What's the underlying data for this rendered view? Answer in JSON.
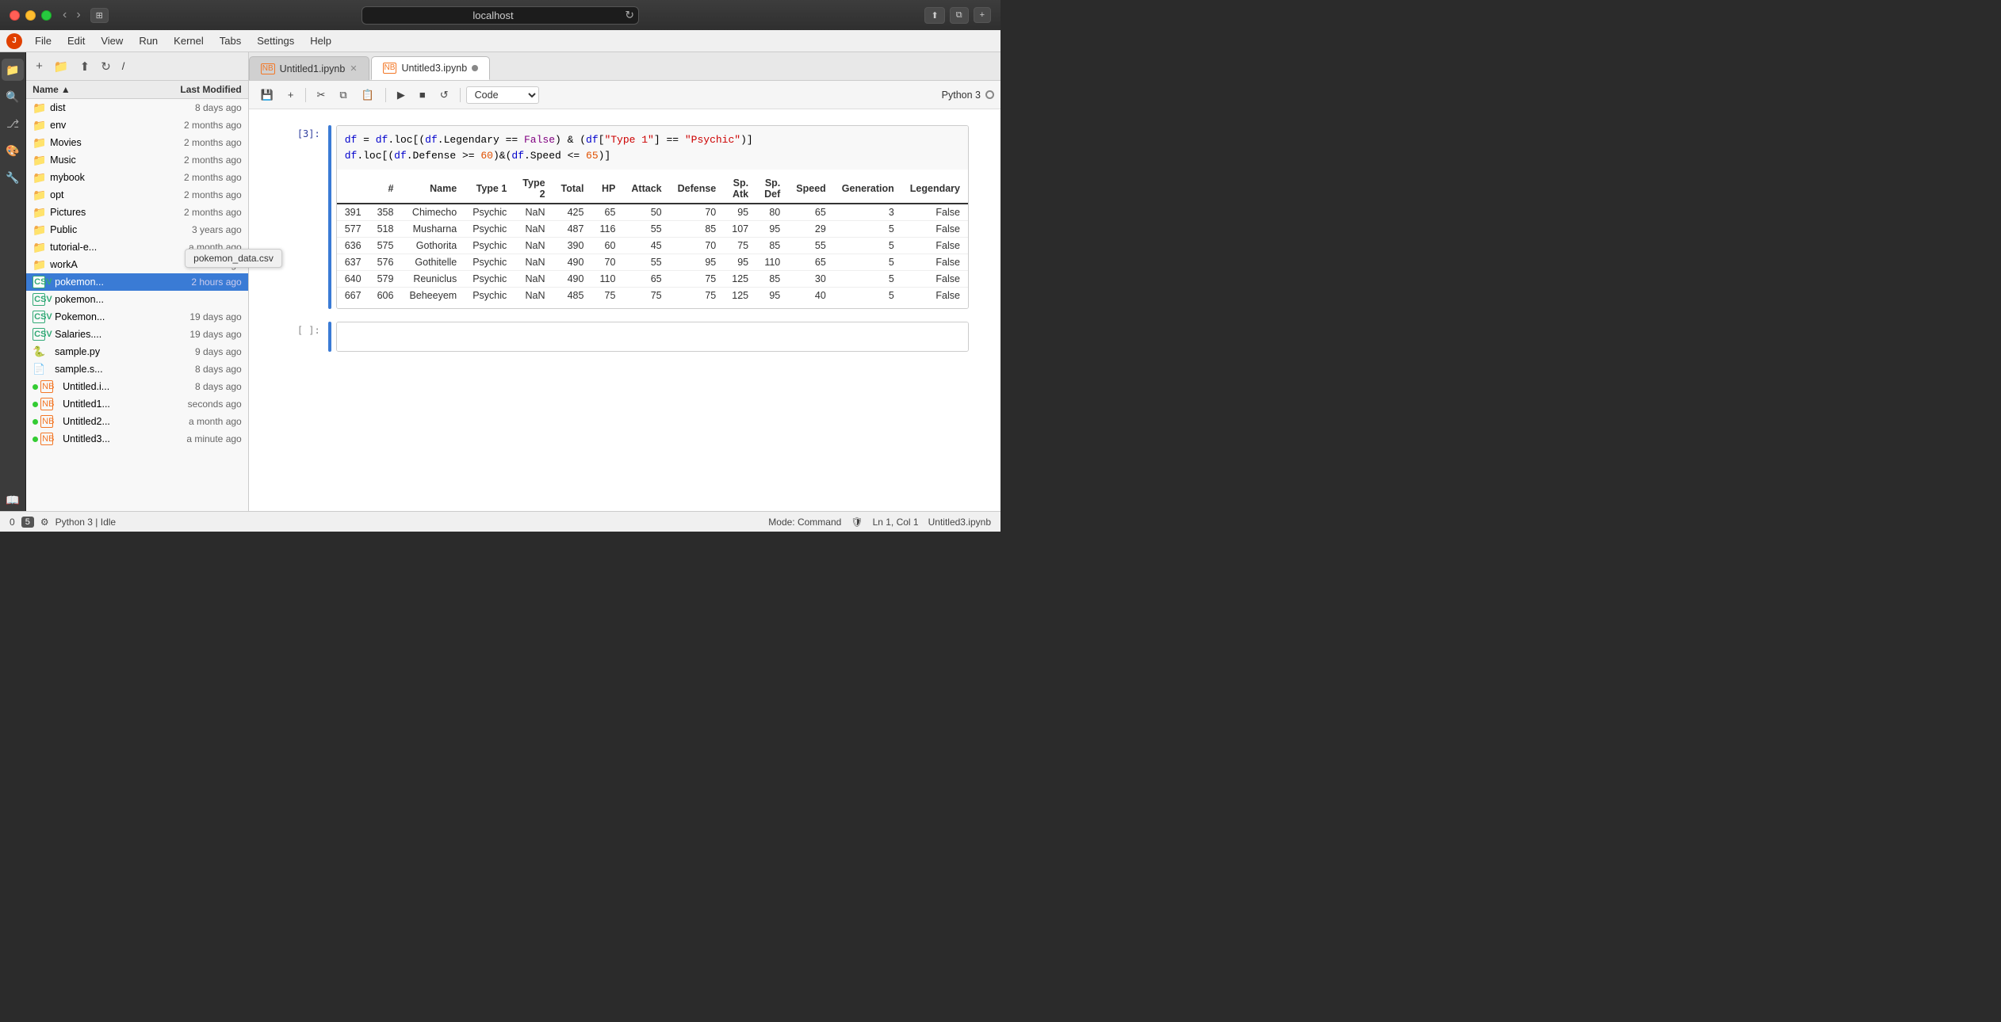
{
  "titlebar": {
    "url": "localhost",
    "new_tab_label": "+"
  },
  "menubar": {
    "items": [
      "File",
      "Edit",
      "View",
      "Run",
      "Kernel",
      "Tabs",
      "Settings",
      "Help"
    ]
  },
  "file_panel": {
    "breadcrumb": "/",
    "columns": {
      "name": "Name",
      "modified": "Last Modified"
    },
    "sort_indicator": "▲",
    "files": [
      {
        "id": "dist",
        "type": "folder",
        "name": "dist",
        "modified": "8 days ago"
      },
      {
        "id": "env",
        "type": "folder",
        "name": "env",
        "modified": "2 months ago"
      },
      {
        "id": "movies",
        "type": "folder",
        "name": "Movies",
        "modified": "2 months ago"
      },
      {
        "id": "music",
        "type": "folder",
        "name": "Music",
        "modified": "2 months ago"
      },
      {
        "id": "mybook",
        "type": "folder",
        "name": "mybook",
        "modified": "2 months ago"
      },
      {
        "id": "opt",
        "type": "folder",
        "name": "opt",
        "modified": "2 months ago"
      },
      {
        "id": "pictures",
        "type": "folder",
        "name": "Pictures",
        "modified": "2 months ago"
      },
      {
        "id": "public",
        "type": "folder",
        "name": "Public",
        "modified": "3 years ago"
      },
      {
        "id": "tutorial-e",
        "type": "folder",
        "name": "tutorial-e...",
        "modified": "a month ago"
      },
      {
        "id": "worka",
        "type": "folder",
        "name": "workA",
        "modified": "a month ago"
      },
      {
        "id": "pokemon-csv-selected",
        "type": "csv",
        "name": "pokemon...",
        "modified": "2 hours ago",
        "selected": true
      },
      {
        "id": "pokemon-csv-2",
        "type": "csv",
        "name": "pokemon...",
        "modified": ""
      },
      {
        "id": "pokemon-caps",
        "type": "csv",
        "name": "Pokemon...",
        "modified": "19 days ago"
      },
      {
        "id": "salaries",
        "type": "csv",
        "name": "Salaries....",
        "modified": "19 days ago"
      },
      {
        "id": "sample-py",
        "type": "py",
        "name": "sample.py",
        "modified": "9 days ago"
      },
      {
        "id": "sample-s",
        "type": "txt",
        "name": "sample.s...",
        "modified": "8 days ago"
      },
      {
        "id": "untitled-i",
        "type": "nb",
        "name": "Untitled.i...",
        "modified": "8 days ago",
        "dot": true
      },
      {
        "id": "untitled1",
        "type": "nb",
        "name": "Untitled1...",
        "modified": "seconds ago",
        "dot": true
      },
      {
        "id": "untitled2",
        "type": "nb",
        "name": "Untitled2...",
        "modified": "a month ago",
        "dot": true
      },
      {
        "id": "untitled3",
        "type": "nb",
        "name": "Untitled3...",
        "modified": "a minute ago",
        "dot": true
      }
    ],
    "tooltip": "pokemon_data.csv"
  },
  "notebook": {
    "tabs": [
      {
        "id": "untitled1-tab",
        "icon": "nb",
        "label": "Untitled1.ipynb",
        "active": false,
        "dot": false
      },
      {
        "id": "untitled3-tab",
        "icon": "nb",
        "label": "Untitled3.ipynb",
        "active": true,
        "dot": true
      }
    ],
    "toolbar": {
      "save": "💾",
      "add_cell": "+",
      "cut": "✂",
      "copy": "⧉",
      "paste": "📋",
      "run": "▶",
      "stop": "■",
      "restart": "↺",
      "cell_type": "Code",
      "cell_type_arrow": "▾"
    },
    "kernel_info": "Python 3",
    "cells": [
      {
        "id": "cell-1",
        "prompt": "[3]:",
        "type": "code",
        "active": false,
        "code_html": "df = df.loc[(df.Legendary == False) & (df[\"Type 1\"] == \"Psychic\")]\ndf.loc[(df.Defense >= 60)&(df.Speed <= 65)]"
      }
    ],
    "output": {
      "headers": [
        "#",
        "Name",
        "Type 1",
        "Type 2",
        "Total",
        "HP",
        "Attack",
        "Defense",
        "Sp. Atk",
        "Sp. Def",
        "Speed",
        "Generation",
        "Legendary"
      ],
      "rows": [
        {
          "idx": "391",
          "num": "358",
          "name": "Chimecho",
          "type1": "Psychic",
          "type2": "NaN",
          "total": "425",
          "hp": "65",
          "attack": "50",
          "defense": "70",
          "spatk": "95",
          "spdef": "80",
          "speed": "65",
          "gen": "3",
          "legendary": "False"
        },
        {
          "idx": "577",
          "num": "518",
          "name": "Musharna",
          "type1": "Psychic",
          "type2": "NaN",
          "total": "487",
          "hp": "116",
          "attack": "55",
          "defense": "85",
          "spatk": "107",
          "spdef": "95",
          "speed": "29",
          "gen": "5",
          "legendary": "False"
        },
        {
          "idx": "636",
          "num": "575",
          "name": "Gothorita",
          "type1": "Psychic",
          "type2": "NaN",
          "total": "390",
          "hp": "60",
          "attack": "45",
          "defense": "70",
          "spatk": "75",
          "spdef": "85",
          "speed": "55",
          "gen": "5",
          "legendary": "False"
        },
        {
          "idx": "637",
          "num": "576",
          "name": "Gothitelle",
          "type1": "Psychic",
          "type2": "NaN",
          "total": "490",
          "hp": "70",
          "attack": "55",
          "defense": "95",
          "spatk": "95",
          "spdef": "110",
          "speed": "65",
          "gen": "5",
          "legendary": "False"
        },
        {
          "idx": "640",
          "num": "579",
          "name": "Reuniclus",
          "type1": "Psychic",
          "type2": "NaN",
          "total": "490",
          "hp": "110",
          "attack": "65",
          "defense": "75",
          "spatk": "125",
          "spdef": "85",
          "speed": "30",
          "gen": "5",
          "legendary": "False"
        },
        {
          "idx": "667",
          "num": "606",
          "name": "Beheeyem",
          "type1": "Psychic",
          "type2": "NaN",
          "total": "485",
          "hp": "75",
          "attack": "75",
          "defense": "75",
          "spatk": "125",
          "spdef": "95",
          "speed": "40",
          "gen": "5",
          "legendary": "False"
        }
      ]
    },
    "empty_cell_prompt": "[ ]:"
  },
  "statusbar": {
    "indicator": "0",
    "python_info": "Python 3 | Idle",
    "mode": "Mode: Command",
    "position": "Ln 1, Col 1",
    "notebook_name": "Untitled3.ipynb",
    "badge_5": "5"
  }
}
